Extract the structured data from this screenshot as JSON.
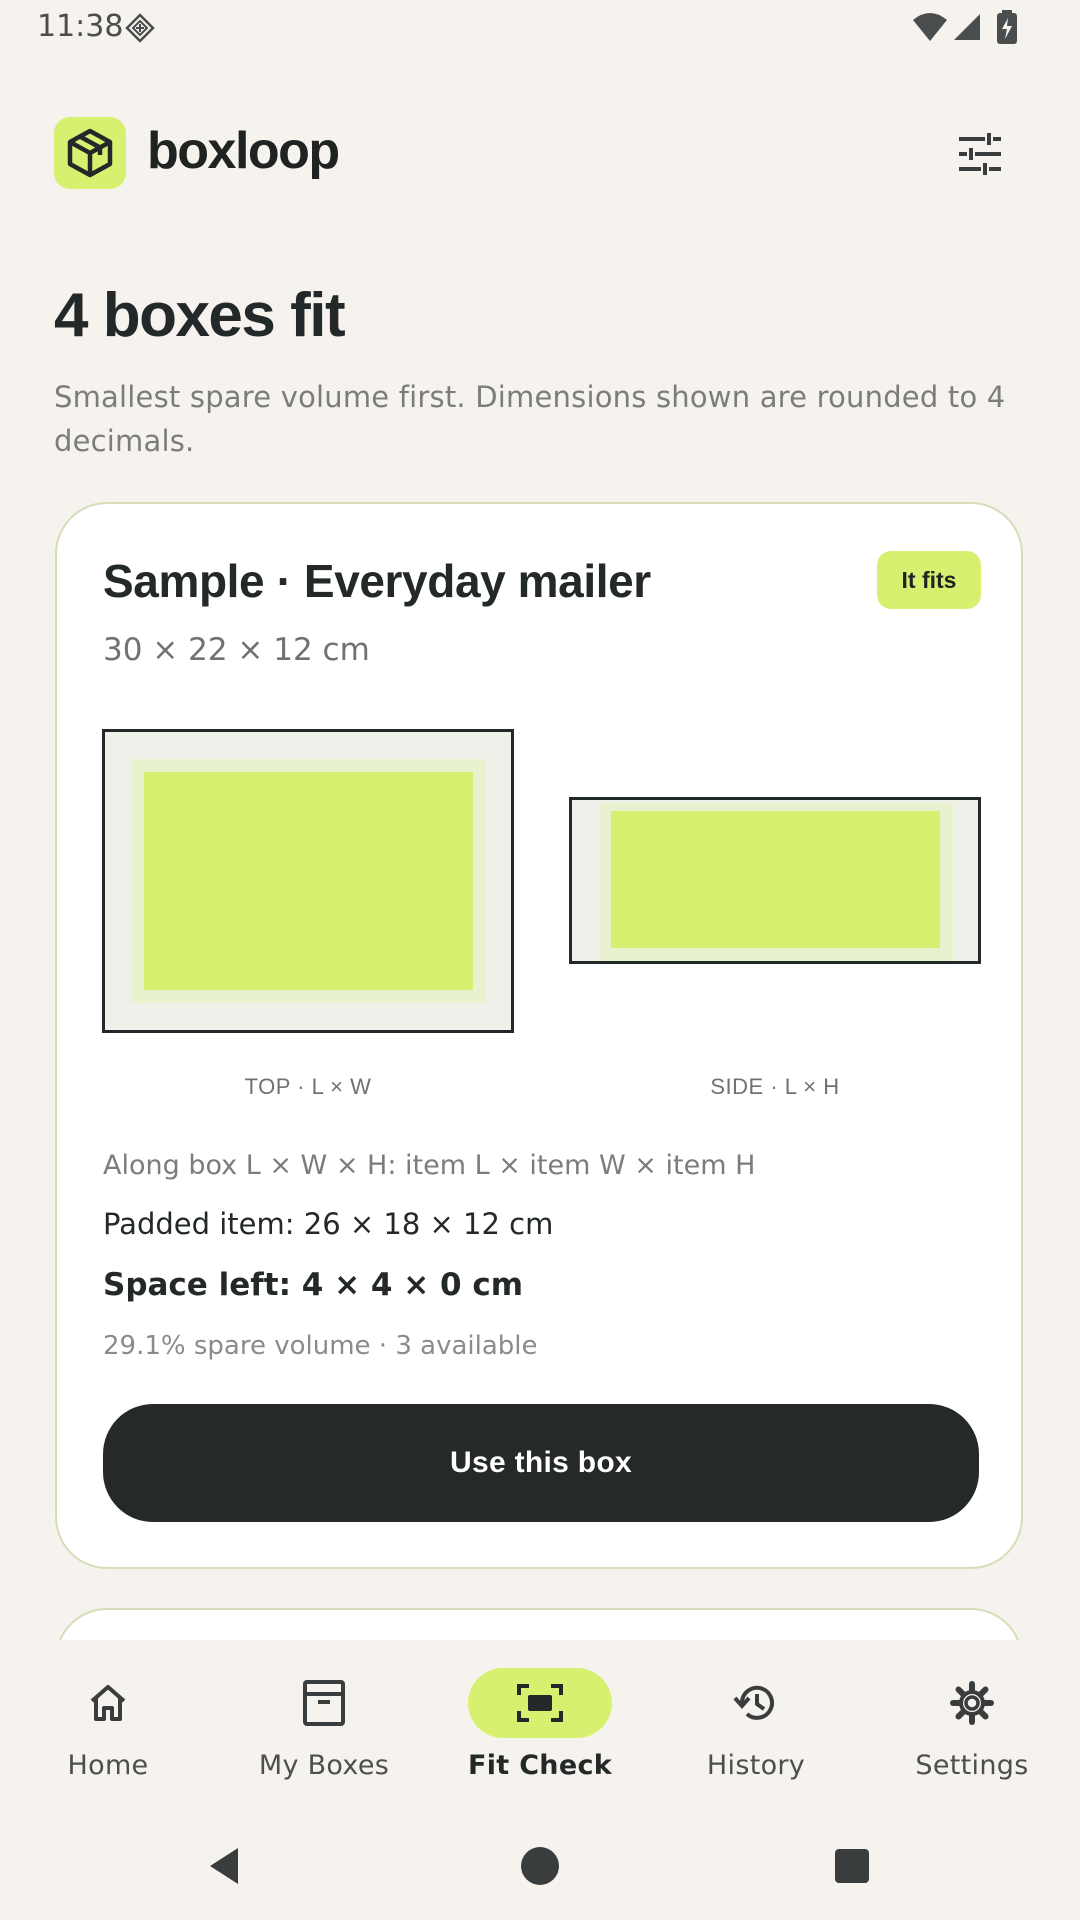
{
  "status_bar": {
    "time": "11:38"
  },
  "header": {
    "app_name": "boxloop"
  },
  "headline": {
    "title": "4 boxes fit",
    "subtitle": "Smallest spare volume first. Dimensions shown are rounded to 4 decimals."
  },
  "card": {
    "title": "Sample · Everyday mailer",
    "badge": "It fits",
    "dimensions": "30 × 22 × 12 cm",
    "top_view_label": "TOP · L × W",
    "side_view_label": "SIDE · L × H",
    "orientation": "Along box L × W × H: item L × item W × item H",
    "padded_item": "Padded item: 26 × 18 × 12 cm",
    "space_left": "Space left: 4 × 4 × 0 cm",
    "spare_volume": "29.1% spare volume · 3 available",
    "button_label": "Use this box"
  },
  "nav": {
    "items": [
      {
        "label": "Home",
        "icon": "home-icon"
      },
      {
        "label": "My Boxes",
        "icon": "archive-box-icon"
      },
      {
        "label": "Fit Check",
        "icon": "fit-check-icon",
        "active": true
      },
      {
        "label": "History",
        "icon": "history-icon"
      },
      {
        "label": "Settings",
        "icon": "gear-icon"
      }
    ]
  },
  "colors": {
    "accent": "#D8F070",
    "dark": "#232828",
    "background": "#F6F3EE"
  }
}
